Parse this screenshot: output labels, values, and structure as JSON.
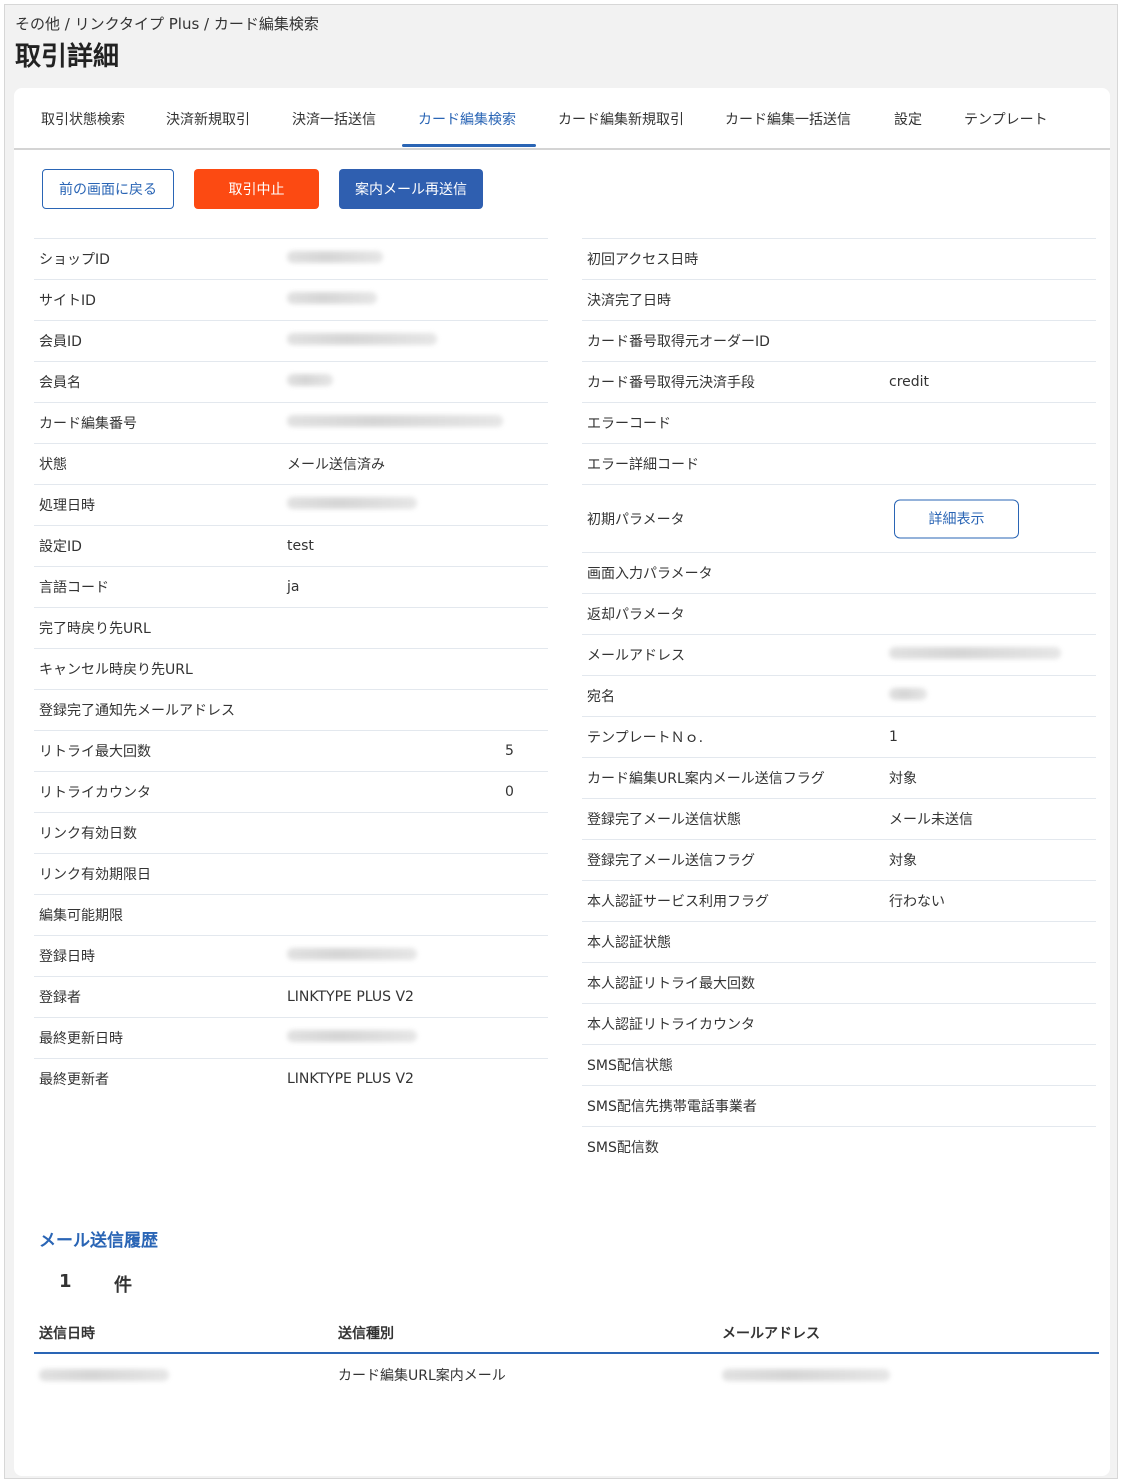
{
  "header": {
    "breadcrumb": "その他 / リンクタイプ Plus / カード編集検索",
    "title": "取引詳細"
  },
  "tabs": [
    {
      "label": "取引状態検索",
      "active": false
    },
    {
      "label": "決済新規取引",
      "active": false
    },
    {
      "label": "決済一括送信",
      "active": false
    },
    {
      "label": "カード編集検索",
      "active": true
    },
    {
      "label": "カード編集新規取引",
      "active": false
    },
    {
      "label": "カード編集一括送信",
      "active": false
    },
    {
      "label": "設定",
      "active": false
    },
    {
      "label": "テンプレート",
      "active": false
    }
  ],
  "actions": {
    "back_label": "前の画面に戻る",
    "cancel_label": "取引中止",
    "resend_label": "案内メール再送信"
  },
  "details_left": [
    {
      "label": "ショップID",
      "value": "",
      "redacted": true
    },
    {
      "label": "サイトID",
      "value": "",
      "redacted": true
    },
    {
      "label": "会員ID",
      "value": "",
      "redacted": true
    },
    {
      "label": "会員名",
      "value": "",
      "redacted": true
    },
    {
      "label": "カード編集番号",
      "value": "",
      "redacted": true
    },
    {
      "label": "状態",
      "value": "メール送信済み"
    },
    {
      "label": "処理日時",
      "value": "",
      "redacted": true
    },
    {
      "label": "設定ID",
      "value": "test"
    },
    {
      "label": "言語コード",
      "value": "ja"
    },
    {
      "label": "完了時戻り先URL",
      "value": ""
    },
    {
      "label": "キャンセル時戻り先URL",
      "value": ""
    },
    {
      "label": "登録完了通知先メールアドレス",
      "value": ""
    },
    {
      "label": "リトライ最大回数",
      "value": "5"
    },
    {
      "label": "リトライカウンタ",
      "value": "0"
    },
    {
      "label": "リンク有効日数",
      "value": ""
    },
    {
      "label": "リンク有効期限日",
      "value": ""
    },
    {
      "label": "編集可能期限",
      "value": ""
    },
    {
      "label": "登録日時",
      "value": "",
      "redacted": true
    },
    {
      "label": "登録者",
      "value": "LINKTYPE PLUS V2"
    },
    {
      "label": "最終更新日時",
      "value": "",
      "redacted": true
    },
    {
      "label": "最終更新者",
      "value": "LINKTYPE PLUS V2"
    }
  ],
  "details_right": [
    {
      "label": "初回アクセス日時",
      "value": ""
    },
    {
      "label": "決済完了日時",
      "value": ""
    },
    {
      "label": "カード番号取得元オーダーID",
      "value": ""
    },
    {
      "label": "カード番号取得元決済手段",
      "value": "credit"
    },
    {
      "label": "エラーコード",
      "value": ""
    },
    {
      "label": "エラー詳細コード",
      "value": ""
    },
    {
      "label": "初期パラメータ",
      "value": "",
      "button": "詳細表示"
    },
    {
      "label": "画面入力パラメータ",
      "value": ""
    },
    {
      "label": "返却パラメータ",
      "value": ""
    },
    {
      "label": "メールアドレス",
      "value": "",
      "redacted": true
    },
    {
      "label": "宛名",
      "value": "",
      "redacted": true
    },
    {
      "label": "テンプレートＮｏ.",
      "value": "1"
    },
    {
      "label": "カード編集URL案内メール送信フラグ",
      "value": "対象"
    },
    {
      "label": "登録完了メール送信状態",
      "value": "メール未送信"
    },
    {
      "label": "登録完了メール送信フラグ",
      "value": "対象"
    },
    {
      "label": "本人認証サービス利用フラグ",
      "value": "行わない"
    },
    {
      "label": "本人認証状態",
      "value": ""
    },
    {
      "label": "本人認証リトライ最大回数",
      "value": ""
    },
    {
      "label": "本人認証リトライカウンタ",
      "value": ""
    },
    {
      "label": "SMS配信状態",
      "value": ""
    },
    {
      "label": "SMS配信先携帯電話事業者",
      "value": ""
    },
    {
      "label": "SMS配信数",
      "value": ""
    }
  ],
  "history": {
    "title": "メール送信履歴",
    "count": "1",
    "count_unit": "件",
    "columns": [
      "送信日時",
      "送信種別",
      "メールアドレス"
    ],
    "rows": [
      {
        "sent_at": "",
        "type": "カード編集URL案内メール",
        "email": ""
      }
    ]
  }
}
